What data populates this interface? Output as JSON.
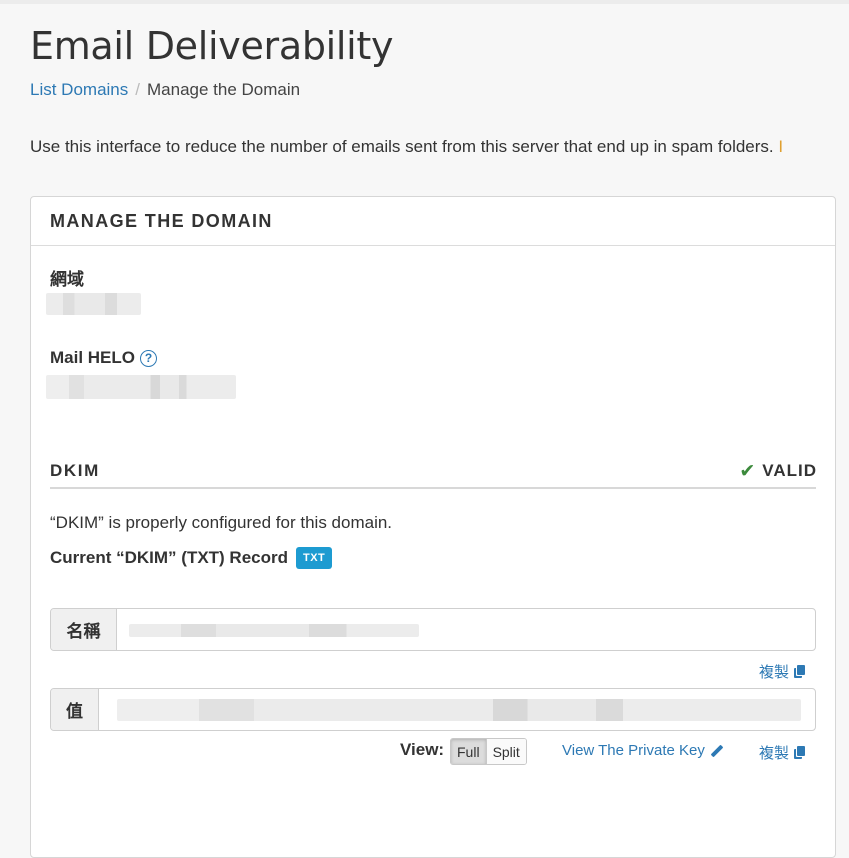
{
  "page": {
    "title": "Email Deliverability",
    "breadcrumb": {
      "link": "List Domains",
      "separator": "/",
      "current": "Manage the Domain"
    },
    "intro": "Use this interface to reduce the number of emails sent from this server that end up in spam folders.",
    "intro_cut": "I"
  },
  "panel": {
    "header": "MANAGE THE DOMAIN",
    "domain_label": "網域",
    "helo_label": "Mail HELO",
    "help_glyph": "?"
  },
  "dkim": {
    "title": "DKIM",
    "status": "VALID",
    "check_glyph": "✔",
    "description": "“DKIM” is properly configured for this domain.",
    "record_label": "Current “DKIM” (TXT) Record",
    "badge": "TXT",
    "name_label": "名稱",
    "value_label": "值",
    "copy_label": "複製",
    "view_label": "View:",
    "view_options": [
      "Full",
      "Split"
    ],
    "view_selected": "Full",
    "private_key_label": "View The Private Key"
  },
  "colors": {
    "link": "#2d79b4",
    "badge": "#1d9bd1",
    "valid": "#3c8a3c"
  }
}
